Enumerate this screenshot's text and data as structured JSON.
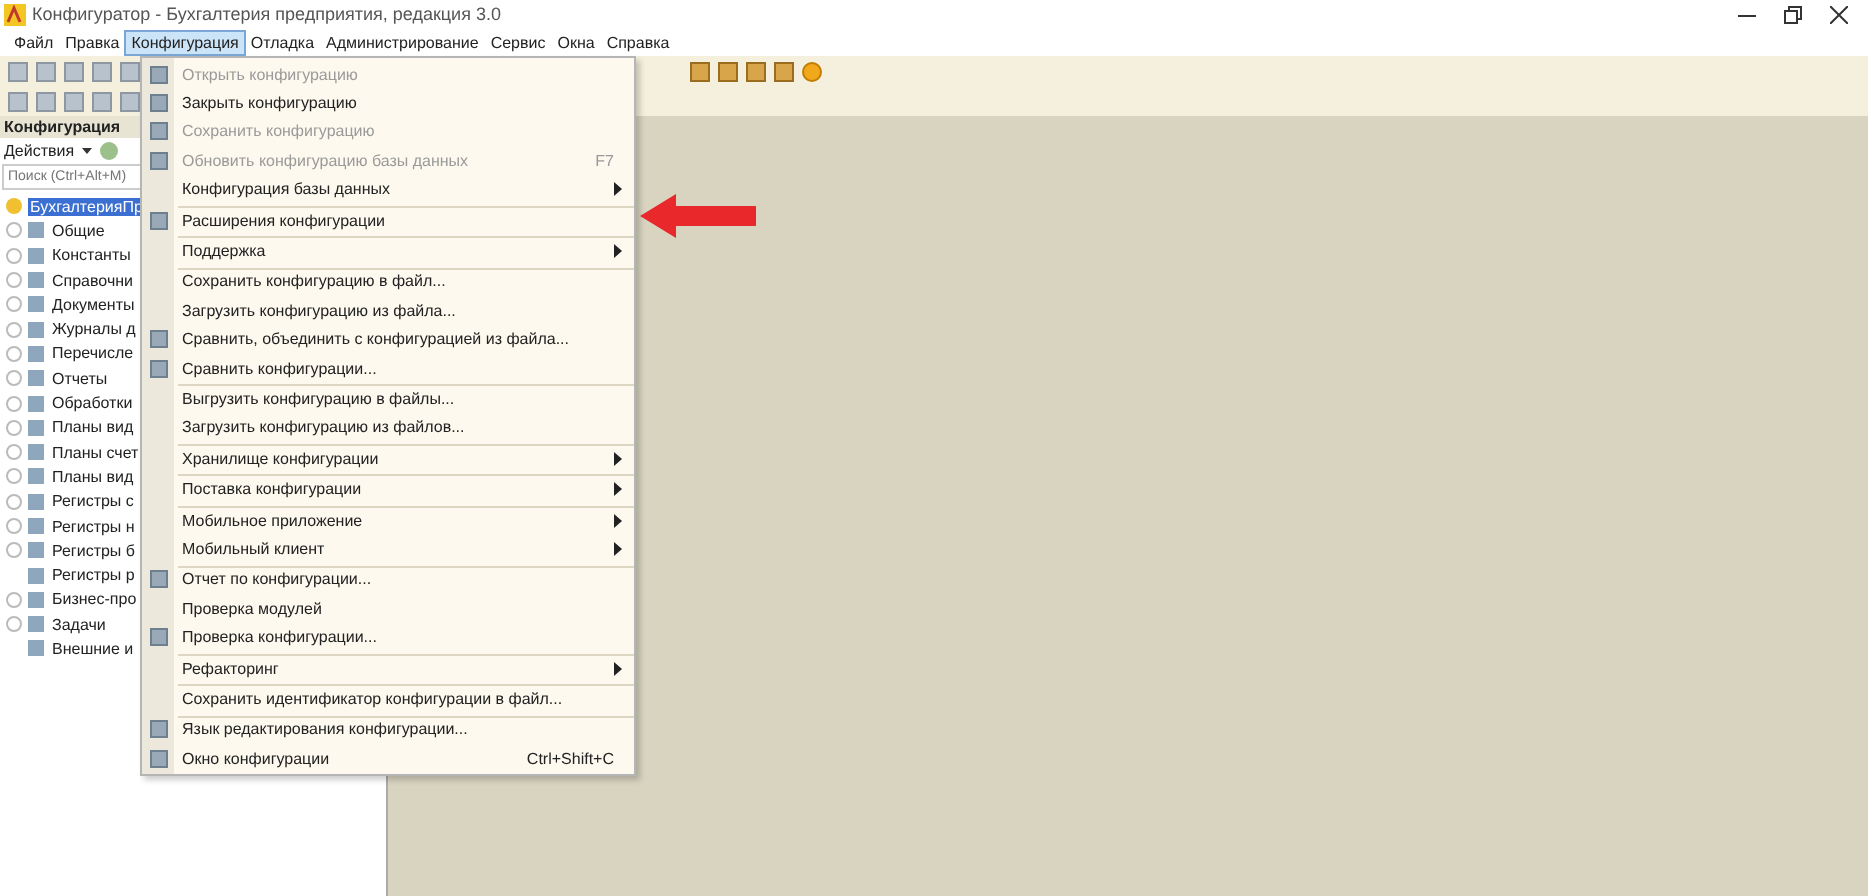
{
  "window": {
    "title": "Конфигуратор - Бухгалтерия предприятия, редакция 3.0"
  },
  "menu_bar": [
    {
      "label": "Файл",
      "selected": false
    },
    {
      "label": "Правка",
      "selected": false
    },
    {
      "label": "Конфигурация",
      "selected": true
    },
    {
      "label": "Отладка",
      "selected": false
    },
    {
      "label": "Администрирование",
      "selected": false
    },
    {
      "label": "Сервис",
      "selected": false
    },
    {
      "label": "Окна",
      "selected": false
    },
    {
      "label": "Справка",
      "selected": false
    }
  ],
  "left_panel": {
    "title": "Конфигурация",
    "actions_label": "Действия",
    "search": {
      "placeholder": "Поиск (Ctrl+Alt+M)"
    },
    "tree": [
      {
        "label": "БухгалтерияПр",
        "selected": true,
        "expandable": false,
        "children": [
          {
            "label": "Общие",
            "selected": false,
            "expandable": true
          },
          {
            "label": "Константы",
            "selected": false,
            "expandable": true
          },
          {
            "label": "Справочни",
            "selected": false,
            "expandable": true
          },
          {
            "label": "Документы",
            "selected": false,
            "expandable": true
          },
          {
            "label": "Журналы д",
            "selected": false,
            "expandable": true
          },
          {
            "label": "Перечисле",
            "selected": false,
            "expandable": true
          },
          {
            "label": "Отчеты",
            "selected": false,
            "expandable": true
          },
          {
            "label": "Обработки",
            "selected": false,
            "expandable": true
          },
          {
            "label": "Планы вид",
            "selected": false,
            "expandable": true
          },
          {
            "label": "Планы счет",
            "selected": false,
            "expandable": true
          },
          {
            "label": "Планы вид",
            "selected": false,
            "expandable": true
          },
          {
            "label": "Регистры с",
            "selected": false,
            "expandable": true
          },
          {
            "label": "Регистры н",
            "selected": false,
            "expandable": true
          },
          {
            "label": "Регистры б",
            "selected": false,
            "expandable": true
          },
          {
            "label": "Регистры р",
            "selected": false,
            "expandable": false
          },
          {
            "label": "Бизнес-про",
            "selected": false,
            "expandable": true
          },
          {
            "label": "Задачи",
            "selected": false,
            "expandable": true
          },
          {
            "label": "Внешние и",
            "selected": false,
            "expandable": false
          }
        ]
      }
    ]
  },
  "dropdown_menu": [
    {
      "label": "Открыть конфигурацию",
      "disabled": true,
      "submenu": false,
      "separator_before": false
    },
    {
      "label": "Закрыть конфигурацию",
      "disabled": false,
      "submenu": false,
      "separator_before": false
    },
    {
      "label": "Сохранить конфигурацию",
      "disabled": true,
      "submenu": false,
      "separator_before": false
    },
    {
      "label": "Обновить конфигурацию базы данных",
      "shortcut": "F7",
      "disabled": true,
      "submenu": false,
      "separator_before": false
    },
    {
      "label": "Конфигурация базы данных",
      "disabled": false,
      "submenu": true,
      "separator_before": false
    },
    {
      "label": "Расширения конфигурации",
      "disabled": false,
      "submenu": false,
      "separator_before": true
    },
    {
      "label": "Поддержка",
      "disabled": false,
      "submenu": true,
      "separator_before": true
    },
    {
      "label": "Сохранить конфигурацию в файл...",
      "disabled": false,
      "submenu": false,
      "separator_before": true
    },
    {
      "label": "Загрузить конфигурацию из файла...",
      "disabled": false,
      "submenu": false,
      "separator_before": false
    },
    {
      "label": "Сравнить, объединить с конфигурацией из файла...",
      "disabled": false,
      "submenu": false,
      "separator_before": false
    },
    {
      "label": "Сравнить конфигурации...",
      "disabled": false,
      "submenu": false,
      "separator_before": false
    },
    {
      "label": "Выгрузить конфигурацию в файлы...",
      "disabled": false,
      "submenu": false,
      "separator_before": true
    },
    {
      "label": "Загрузить конфигурацию из файлов...",
      "disabled": false,
      "submenu": false,
      "separator_before": false
    },
    {
      "label": "Хранилище конфигурации",
      "disabled": false,
      "submenu": true,
      "separator_before": true
    },
    {
      "label": "Поставка конфигурации",
      "disabled": false,
      "submenu": true,
      "separator_before": true
    },
    {
      "label": "Мобильное приложение",
      "disabled": false,
      "submenu": true,
      "separator_before": true
    },
    {
      "label": "Мобильный клиент",
      "disabled": false,
      "submenu": true,
      "separator_before": false
    },
    {
      "label": "Отчет по конфигурации...",
      "disabled": false,
      "submenu": false,
      "separator_before": true
    },
    {
      "label": "Проверка модулей",
      "disabled": false,
      "submenu": false,
      "separator_before": false
    },
    {
      "label": "Проверка конфигурации...",
      "disabled": false,
      "submenu": false,
      "separator_before": false
    },
    {
      "label": "Рефакторинг",
      "disabled": false,
      "submenu": true,
      "separator_before": true
    },
    {
      "label": "Сохранить идентификатор конфигурации в файл...",
      "disabled": false,
      "submenu": false,
      "separator_before": true
    },
    {
      "label": "Язык редактирования конфигурации...",
      "disabled": false,
      "submenu": false,
      "separator_before": true
    },
    {
      "label": "Окно конфигурации",
      "shortcut": "Ctrl+Shift+C",
      "disabled": false,
      "submenu": false,
      "separator_before": false
    }
  ]
}
